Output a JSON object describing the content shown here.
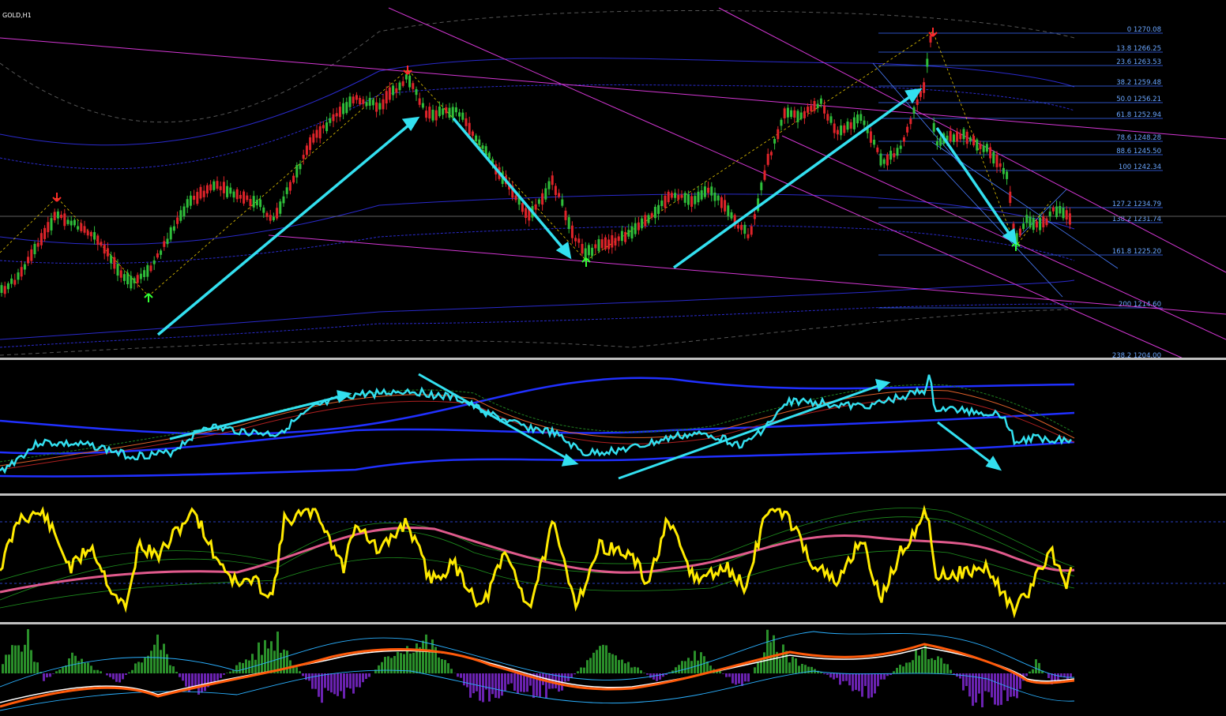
{
  "window": {
    "symbol_label": "GOLD,H1"
  },
  "colors": {
    "background": "#000000",
    "bull_candle": "#2fbf3a",
    "bear_candle": "#e0242a",
    "trendline": "#d437d4",
    "arrow": "#33e0f0",
    "fib": "#3b6cff",
    "fib_text": "#6aa6ff",
    "envelope": "#4040ff",
    "rsi_line": "#ffea00",
    "rsi_ma": "#e05a8c",
    "hist_pos": "#2a8f2a",
    "hist_neg": "#6a22b0",
    "macd_fast": "#ff5a0a",
    "macd_slow": "#ffffff"
  },
  "toolbar": {
    "icons": [
      "new-chart-icon",
      "open-icon",
      "zoom-in-icon",
      "zoom-out-icon",
      "crosshair-icon",
      "line-icon",
      "pencil-icon",
      "chart-bars-icon",
      "chart-candles-icon",
      "chart-line-icon",
      "add-indicator-icon",
      "period-icon",
      "autoscroll-icon",
      "shift-icon"
    ]
  },
  "fibonacci": {
    "levels": [
      {
        "label": "0 1270.08"
      },
      {
        "label": "13.8 1266.25"
      },
      {
        "label": "23.6 1263.53"
      },
      {
        "label": "38.2 1259.48"
      },
      {
        "label": "50.0 1256.21"
      },
      {
        "label": "61.8 1252.94"
      },
      {
        "label": "78.6 1248.28"
      },
      {
        "label": "88.6 1245.50"
      },
      {
        "label": "100 1242.34"
      },
      {
        "label": "127.2 1234.79"
      },
      {
        "label": "138.2 1231.74"
      },
      {
        "label": "161.8 1225.20"
      },
      {
        "label": "200 1214.60"
      },
      {
        "label": "238.2 1204.00"
      }
    ]
  },
  "fractals": [
    {
      "kind": "down"
    },
    {
      "kind": "up"
    },
    {
      "kind": "down"
    },
    {
      "kind": "up"
    },
    {
      "kind": "down"
    },
    {
      "kind": "up"
    }
  ]
}
